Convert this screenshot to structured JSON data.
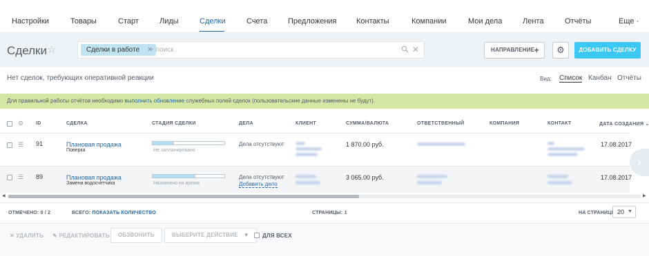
{
  "nav": {
    "items": [
      {
        "label": "Настройки"
      },
      {
        "label": "Товары"
      },
      {
        "label": "Старт"
      },
      {
        "label": "Лиды"
      },
      {
        "label": "Сделки",
        "active": true
      },
      {
        "label": "Счета"
      },
      {
        "label": "Предложения"
      },
      {
        "label": "Контакты"
      },
      {
        "label": "Компании"
      },
      {
        "label": "Мои дела"
      },
      {
        "label": "Лента"
      },
      {
        "label": "Отчёты"
      },
      {
        "label": "Еще ·"
      }
    ]
  },
  "header": {
    "title": "Сделки",
    "star": "☆",
    "filter_chip": "Сделки в работе",
    "chip_close": "×",
    "search_placeholder": "+ поиск",
    "direction_label": "НАПРАВЛЕНИЕ",
    "direction_plus": "+",
    "add_label": "ДОБАВИТЬ СДЕЛКУ"
  },
  "subbar": {
    "no_deals": "Нет сделок, требующих оперативной реакции",
    "view_label": "Вид:",
    "views": [
      "Список",
      "Канбан",
      "Отчёты"
    ],
    "active_view": "Список"
  },
  "notice": {
    "before": "Для правильной работы отчётов необходимо ",
    "link": "выполнить обновление",
    "after": " служебных полей сделок (пользовательские данные изменены не будут)."
  },
  "table": {
    "columns": [
      "ID",
      "СДЕЛКА",
      "СТАДИЯ СДЕЛКИ",
      "ДЕЛА",
      "КЛИЕНТ",
      "СУММА/ВАЛЮТА",
      "ОТВЕТСТВЕННЫЙ",
      "КОМПАНИЯ",
      "КОНТАКТ",
      "ДАТА СОЗДАНИЯ ⌄"
    ],
    "rows": [
      {
        "id": "91",
        "deal": "Плановая продажа",
        "deal_sub": "Поверка",
        "stage_fill": 0.3,
        "stage_text": "Не запланировано",
        "activity": "Дела отсутствуют",
        "activity_add": "",
        "amount": "1 870.00 руб.",
        "date": "17.08.2017"
      },
      {
        "id": "89",
        "deal": "Плановая продажа",
        "deal_sub": "Замена водосчетчика",
        "stage_fill": 0.6,
        "stage_text": "Назначено на время",
        "activity": "Дела отсутствуют",
        "activity_add": "Добавить дело",
        "amount": "3 065.00 руб.",
        "date": "17.08.2017"
      }
    ]
  },
  "footer": {
    "marked_label": "ОТМЕЧЕНО:",
    "marked_value": "0 / 2",
    "total_label": "ВСЕГО:",
    "total_link": "ПОКАЗАТЬ КОЛИЧЕСТВО",
    "pages_label": "СТРАНИЦЫ:",
    "pages_value": "1",
    "per_page_label": "НА СТРАНИЦЕ:",
    "per_page_value": "20"
  },
  "actions": {
    "delete": "УДАЛИТЬ",
    "edit": "РЕДАКТИРОВАТЬ",
    "call": "ОБЗВОНИТЬ",
    "choose": "ВЫБЕРИТЕ ДЕЙСТВИЕ",
    "for_all": "ДЛЯ ВСЕХ"
  },
  "icons": {
    "search": "search-icon",
    "clear": "close-icon",
    "gear": "gear-icon",
    "row_menu": "menu-icon",
    "next": "chevron-right-icon"
  },
  "colors": {
    "accent": "#2067b0",
    "add_button": "#3bc8f5",
    "notice_bg": "#d6e5a3",
    "chip_bg": "#bfe3f0"
  }
}
